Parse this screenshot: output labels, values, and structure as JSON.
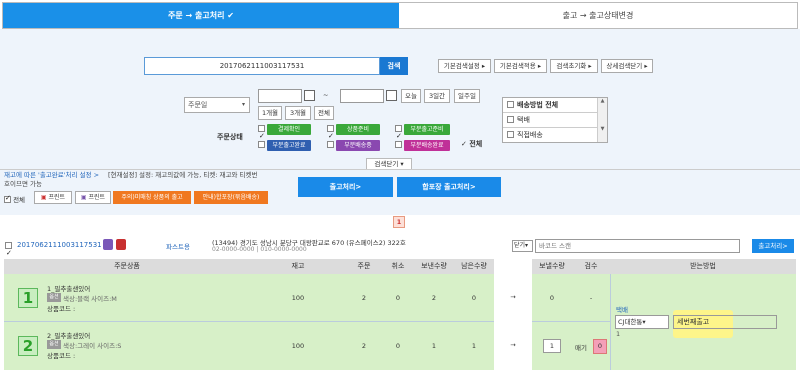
{
  "tabs": {
    "active": "주문 → 출고처리 ✔",
    "other": "출고 → 출고상태변경"
  },
  "search": {
    "value": "2017062111003117531",
    "button": "검색"
  },
  "presets": [
    "기본검색설정 ▸",
    "기본검색적용 ▸",
    "검색초기화 ▸",
    "상세검색닫기 ▸"
  ],
  "date": {
    "select": "주문일",
    "today": "오늘",
    "d3": "3일간",
    "w1": "일주일",
    "m1": "1개월",
    "m3": "3개월",
    "all": "전체"
  },
  "order_status": {
    "label": "주문상태",
    "badges": [
      {
        "text": "결제확인",
        "color": "#3aa83a"
      },
      {
        "text": "상품준비",
        "color": "#3aa83a"
      },
      {
        "text": "부분출고준비",
        "color": "#3aa83a"
      },
      {
        "text": "부분출고완료",
        "color": "#2f5fb0"
      },
      {
        "text": "부분배송중",
        "color": "#8a48b0"
      },
      {
        "text": "부분배송완료",
        "color": "#c03098"
      }
    ],
    "all": "전체"
  },
  "shipping": {
    "title": "배송방법 전체",
    "items": [
      "택배",
      "직접배송"
    ]
  },
  "close_search": "검색닫기 ▾",
  "notice": {
    "link": "재고에 따른 '출고완료'처리 설정 >",
    "text": "[현재설정] 설정: 재고의값에 가능, 티켓: 재고와 티켓번",
    "text2": "호이므면 가능"
  },
  "actions": {
    "ship": "출고처리>",
    "combined": "합포장 출고처리>"
  },
  "print": {
    "all": "전체",
    "p1": "프린트",
    "p2": "프린트",
    "o1": "주의)미매칭 상품의 출고",
    "o2": "안내)합포장(묶음배송)"
  },
  "page": "1",
  "order": {
    "no": "2017062111003117531",
    "recipient": "파스트용",
    "address": "(13494) 경기도 성남시 분당구 대왕판교로 670 (유스페이스2) 322호",
    "phones": "02-0000-0000  |  010-0000-0000",
    "barcode_select": "닫기",
    "barcode_placeholder": "바코드 스캔",
    "ship_btn": "출고처리>"
  },
  "table": {
    "headers": [
      "주문상품",
      "재고",
      "주문",
      "취소",
      "보낸수량",
      "남은수량",
      "",
      "보낼수량",
      "검수",
      "받는방법"
    ],
    "rows": [
      {
        "idx": "1",
        "name": "1_필추출샌있어",
        "opt_tag": "옵션",
        "option": "색상:블랙 사이즈:M",
        "code": "상품코드 :",
        "stock": "100",
        "order": "2",
        "cancel": "0",
        "sent": "2",
        "remain": "0",
        "send": "0",
        "check": "-"
      },
      {
        "idx": "2",
        "name": "2_필추출샌있어",
        "opt_tag": "옵션",
        "option": "색상:그레이 사이즈:S",
        "code": "상품코드 :",
        "stock": "100",
        "order": "2",
        "cancel": "0",
        "sent": "1",
        "remain": "1",
        "send": "1",
        "check": "매기",
        "check2": "0"
      }
    ],
    "method": {
      "label": "택배",
      "carrier": "CJ대한통▾",
      "tracking": "세번째출고",
      "count": "1"
    }
  },
  "colors": {
    "accent": "#1a8ae8",
    "row": "#d7f0c8"
  }
}
